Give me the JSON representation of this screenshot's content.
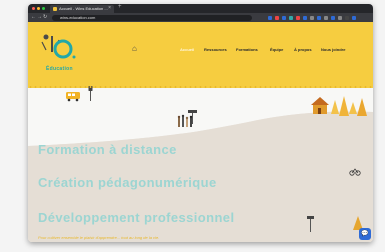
{
  "browser": {
    "tab_title": "Accueil - Wins Education ...",
    "tab_close": "×",
    "new_tab": "+",
    "url": "wins-education.com",
    "nav_back": "←",
    "nav_forward": "→",
    "nav_reload": "↻",
    "dot_colors": [
      "#ff5f57",
      "#febc2e",
      "#28c840"
    ],
    "extension_colors": [
      "#2f6bd6",
      "#e44",
      "#2f6bd6",
      "#3aa",
      "#e44",
      "#2f6bd6",
      "#888",
      "#2f6bd6",
      "#888",
      "#2f6bd6",
      "#888",
      "#444",
      "#2f6bd6"
    ]
  },
  "site": {
    "logo_text": "Éducation",
    "home_icon": "⌂",
    "nav_items": [
      "Accueil",
      "Ressources",
      "Formations",
      "Équipe",
      "À propos",
      "Nous joindre"
    ],
    "active_index": 0,
    "headlines": [
      "Formation à distance",
      "Création pédagonumérique",
      "Développement professionnel"
    ],
    "tagline": "Pour cultiver ensemble le plaisir d'apprendre... tout au long de la vie.",
    "chat_icon": "💬"
  }
}
